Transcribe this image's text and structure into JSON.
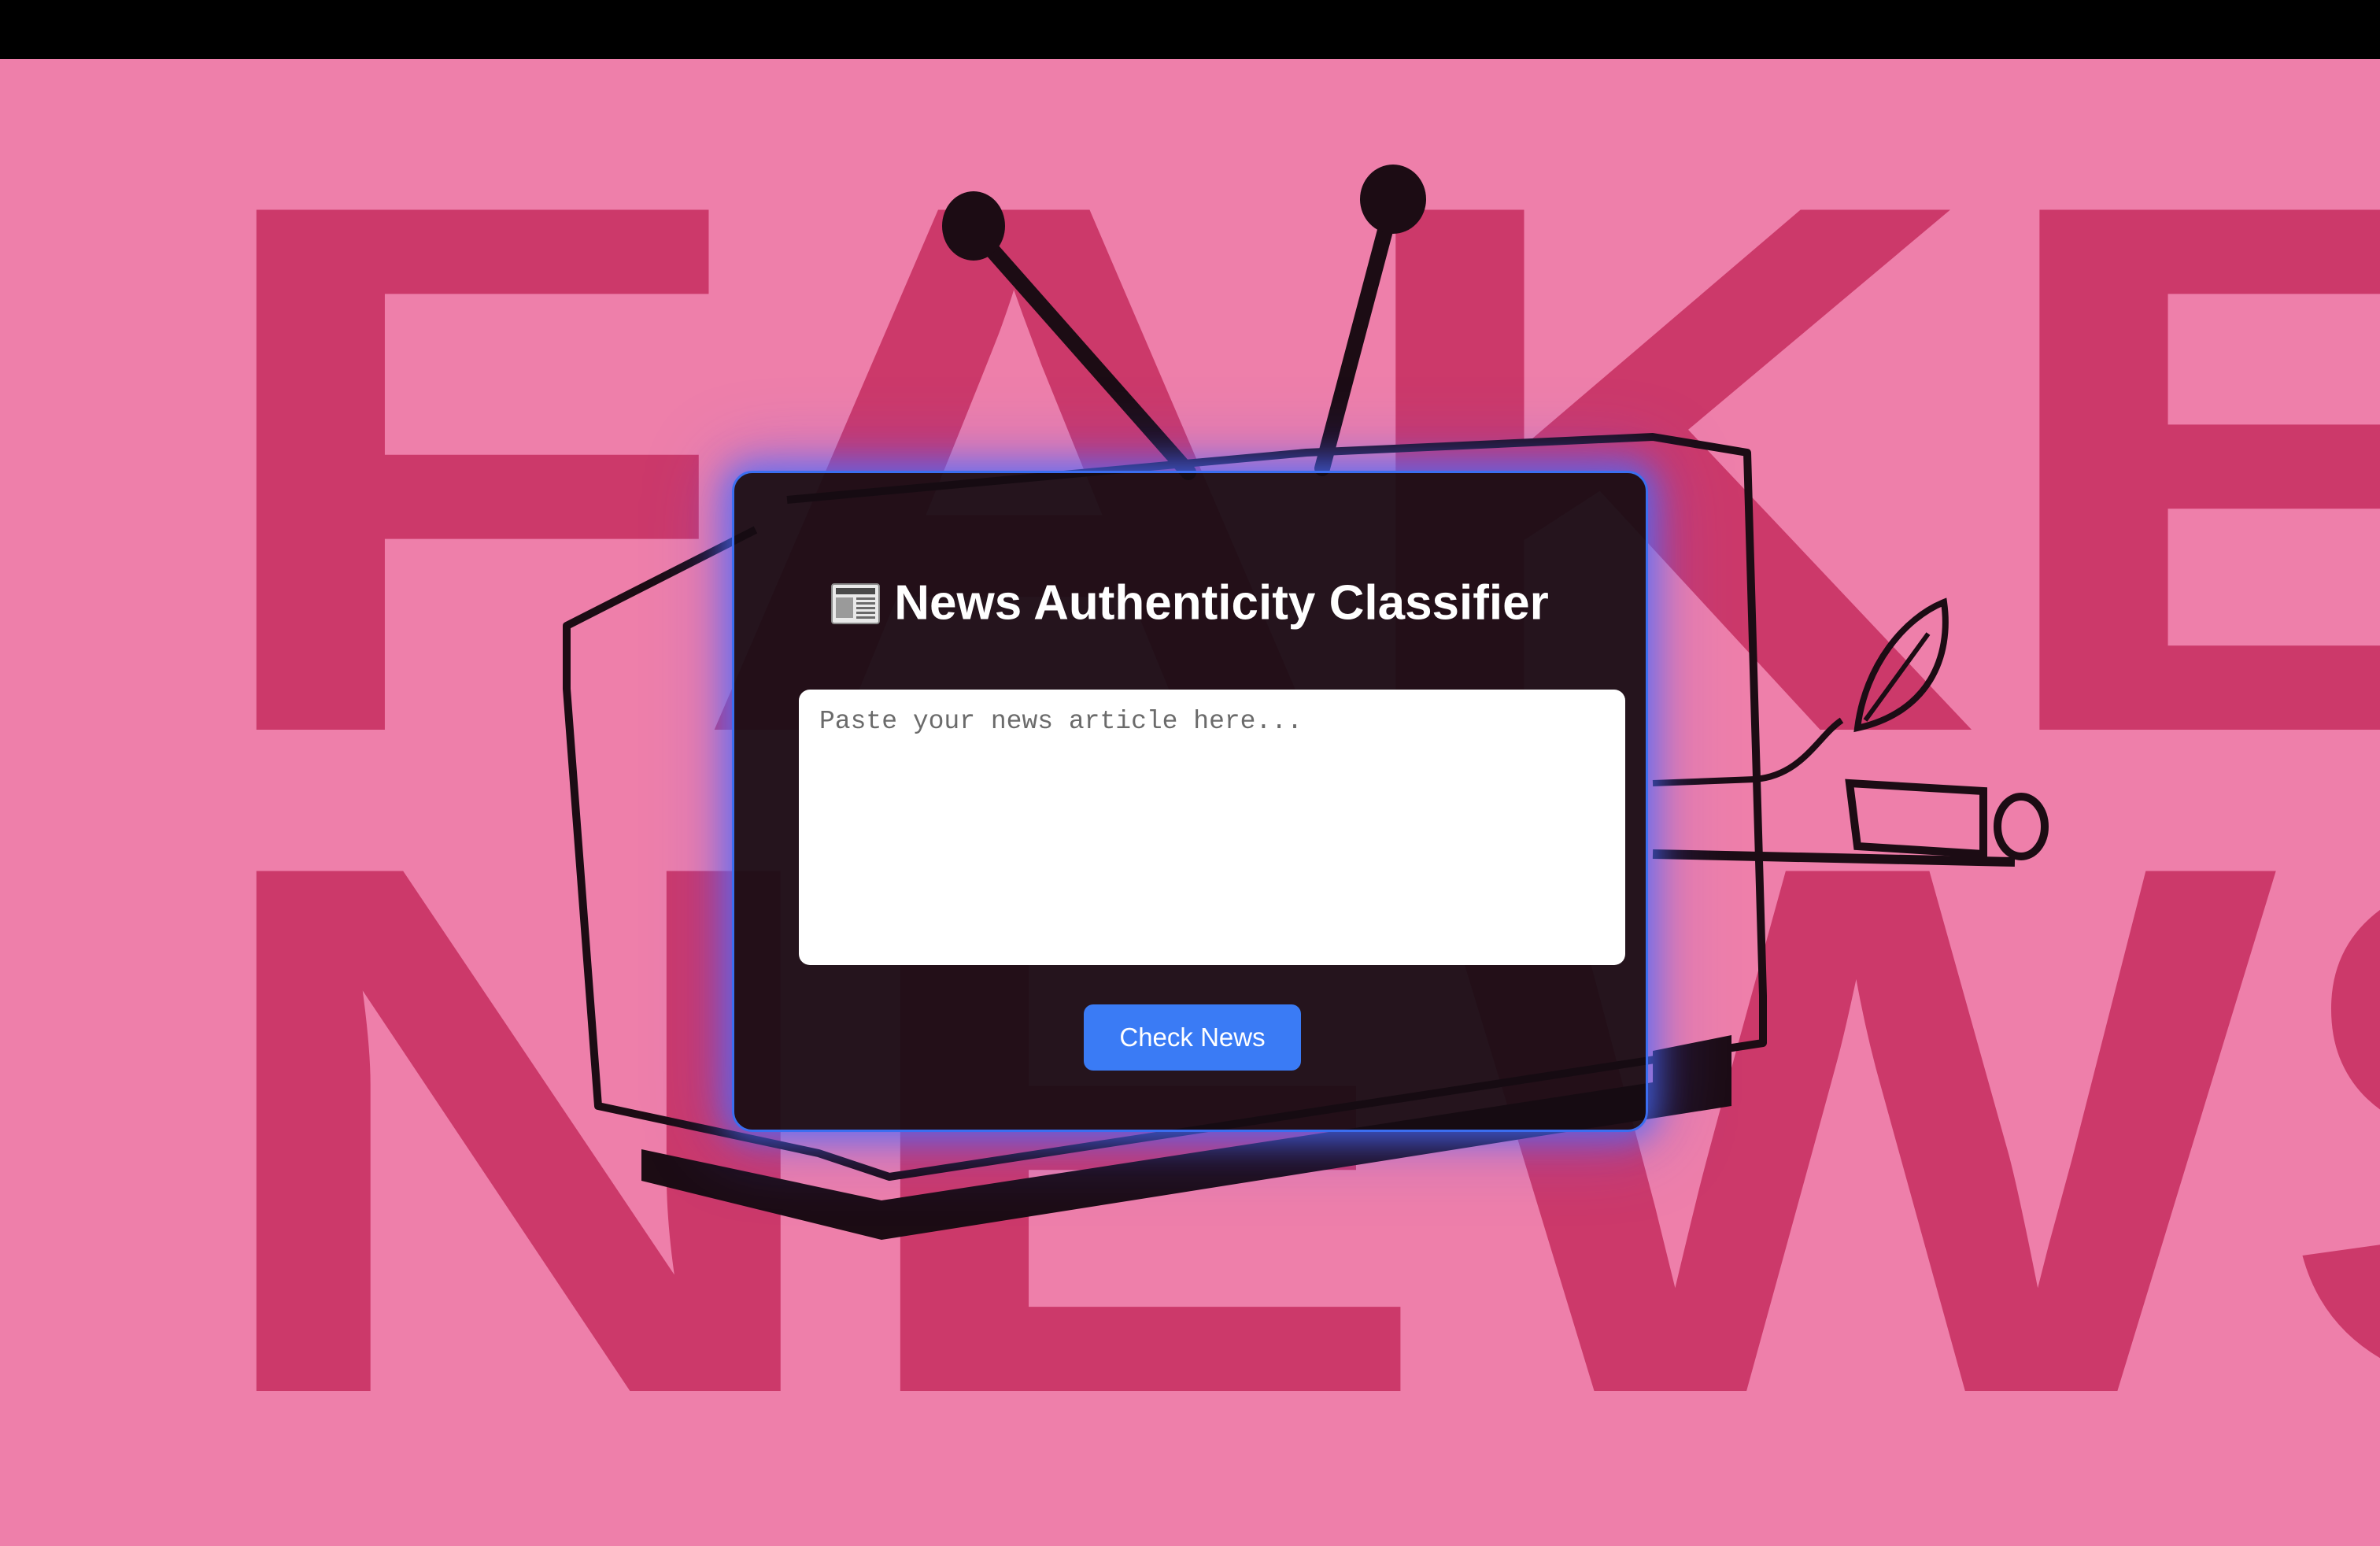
{
  "background": {
    "word_top": "FAKE",
    "word_bottom": "NEWS",
    "base_color": "#ee7faa",
    "letter_color": "#cc396a"
  },
  "card": {
    "title": "News Authenticity Classifier",
    "title_icon": "newspaper-icon",
    "input_placeholder": "Paste your news article here...",
    "input_value": "",
    "button_label": "Check News",
    "accent_color": "#3a7bf5"
  }
}
